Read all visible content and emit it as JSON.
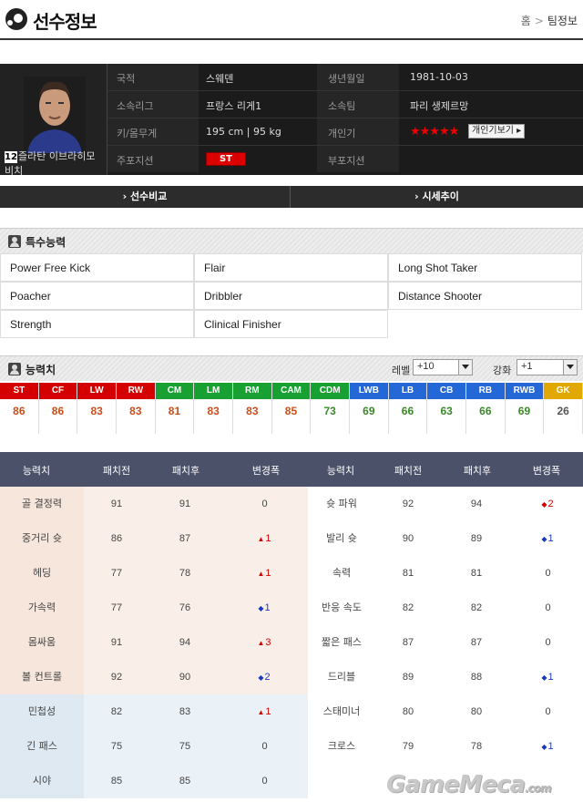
{
  "header": {
    "title": "선수정보",
    "breadcrumb": [
      "홈",
      "팀정보"
    ]
  },
  "player": {
    "number": "12",
    "name_line1": "즐라탄 이브라히모",
    "name_line2": "비치",
    "nationality_label": "국적",
    "nationality": "스웨덴",
    "birth_label": "생년월일",
    "birth": "1981-10-03",
    "league_label": "소속리그",
    "league": "프랑스 리게1",
    "team_label": "소속팀",
    "team": "파리 생제르망",
    "body_label": "키/몸무게",
    "body": "195 cm  |  95 kg",
    "skill_label": "개인기",
    "skill_stars": "★★★★★",
    "skill_rating": 5,
    "personal_btn": "개인기보기 ▸",
    "main_pos_label": "주포지션",
    "main_pos": "ST",
    "sub_pos_label": "부포지션"
  },
  "nav": {
    "compare": "› 선수비교",
    "price": "› 시세추이"
  },
  "traits_section": {
    "title": "특수능력",
    "items": [
      "Power Free Kick",
      "Flair",
      "Long Shot Taker",
      "Poacher",
      "Dribbler",
      "Distance Shooter",
      "Strength",
      "Clinical Finisher"
    ]
  },
  "ability_section": {
    "title": "능력치",
    "level_label": "레벨",
    "level_value": "+10",
    "enhance_label": "강화",
    "enhance_value": "+1"
  },
  "positions": [
    {
      "pos": "ST",
      "val": "86",
      "color": "#d40000",
      "vcolor": "#c8501a"
    },
    {
      "pos": "CF",
      "val": "86",
      "color": "#d40000",
      "vcolor": "#c8501a"
    },
    {
      "pos": "LW",
      "val": "83",
      "color": "#d40000",
      "vcolor": "#c8501a"
    },
    {
      "pos": "RW",
      "val": "83",
      "color": "#d40000",
      "vcolor": "#c8501a"
    },
    {
      "pos": "CM",
      "val": "81",
      "color": "#18a032",
      "vcolor": "#c8501a"
    },
    {
      "pos": "LM",
      "val": "83",
      "color": "#18a032",
      "vcolor": "#c8501a"
    },
    {
      "pos": "RM",
      "val": "83",
      "color": "#18a032",
      "vcolor": "#c8501a"
    },
    {
      "pos": "CAM",
      "val": "85",
      "color": "#18a032",
      "vcolor": "#c8501a"
    },
    {
      "pos": "CDM",
      "val": "73",
      "color": "#18a032",
      "vcolor": "#3a8a2a"
    },
    {
      "pos": "LWB",
      "val": "69",
      "color": "#2468d8",
      "vcolor": "#3a8a2a"
    },
    {
      "pos": "LB",
      "val": "66",
      "color": "#2468d8",
      "vcolor": "#3a8a2a"
    },
    {
      "pos": "CB",
      "val": "63",
      "color": "#2468d8",
      "vcolor": "#3a8a2a"
    },
    {
      "pos": "RB",
      "val": "66",
      "color": "#2468d8",
      "vcolor": "#3a8a2a"
    },
    {
      "pos": "RWB",
      "val": "69",
      "color": "#2468d8",
      "vcolor": "#3a8a2a"
    },
    {
      "pos": "GK",
      "val": "26",
      "color": "#e0a800",
      "vcolor": "#555555"
    }
  ],
  "stats_table": {
    "headers": [
      "능력치",
      "패치전",
      "패치후",
      "변경폭",
      "능력치",
      "패치전",
      "패치후",
      "변경폭"
    ],
    "rows": [
      {
        "l_name": "골 결정력",
        "l_before": "91",
        "l_after": "91",
        "l_diff": "0",
        "l_dir": "none",
        "r_name": "슛 파워",
        "r_before": "92",
        "r_after": "94",
        "r_diff": "2",
        "r_dir": "up"
      },
      {
        "l_name": "중거리 슛",
        "l_before": "86",
        "l_after": "87",
        "l_diff": "1",
        "l_dir": "up",
        "r_name": "발리 슛",
        "r_before": "90",
        "r_after": "89",
        "r_diff": "1",
        "r_dir": "down"
      },
      {
        "l_name": "헤딩",
        "l_before": "77",
        "l_after": "78",
        "l_diff": "1",
        "l_dir": "up",
        "r_name": "속력",
        "r_before": "81",
        "r_after": "81",
        "r_diff": "0",
        "r_dir": "none"
      },
      {
        "l_name": "가속력",
        "l_before": "77",
        "l_after": "76",
        "l_diff": "1",
        "l_dir": "down",
        "r_name": "반응 속도",
        "r_before": "82",
        "r_after": "82",
        "r_diff": "0",
        "r_dir": "none"
      },
      {
        "l_name": "몸싸움",
        "l_before": "91",
        "l_after": "94",
        "l_diff": "3",
        "l_dir": "up",
        "r_name": "짧은 패스",
        "r_before": "87",
        "r_after": "87",
        "r_diff": "0",
        "r_dir": "none"
      },
      {
        "l_name": "볼 컨트롤",
        "l_before": "92",
        "l_after": "90",
        "l_diff": "2",
        "l_dir": "down",
        "r_name": "드리블",
        "r_before": "89",
        "r_after": "88",
        "r_diff": "1",
        "r_dir": "down"
      },
      {
        "l_name": "민첩성",
        "l_before": "82",
        "l_after": "83",
        "l_diff": "1",
        "l_dir": "up",
        "r_name": "스태미너",
        "r_before": "80",
        "r_after": "80",
        "r_diff": "0",
        "r_dir": "none"
      },
      {
        "l_name": "긴 패스",
        "l_before": "75",
        "l_after": "75",
        "l_diff": "0",
        "l_dir": "none",
        "r_name": "크로스",
        "r_before": "79",
        "r_after": "78",
        "r_diff": "1",
        "r_dir": "down"
      },
      {
        "l_name": "시야",
        "l_before": "85",
        "l_after": "85",
        "l_diff": "0",
        "l_dir": "none",
        "r_name": "",
        "r_before": "",
        "r_after": "",
        "r_diff": "",
        "r_dir": "none"
      }
    ]
  },
  "watermark": {
    "text": "GameMeca",
    "suffix": ".com"
  }
}
